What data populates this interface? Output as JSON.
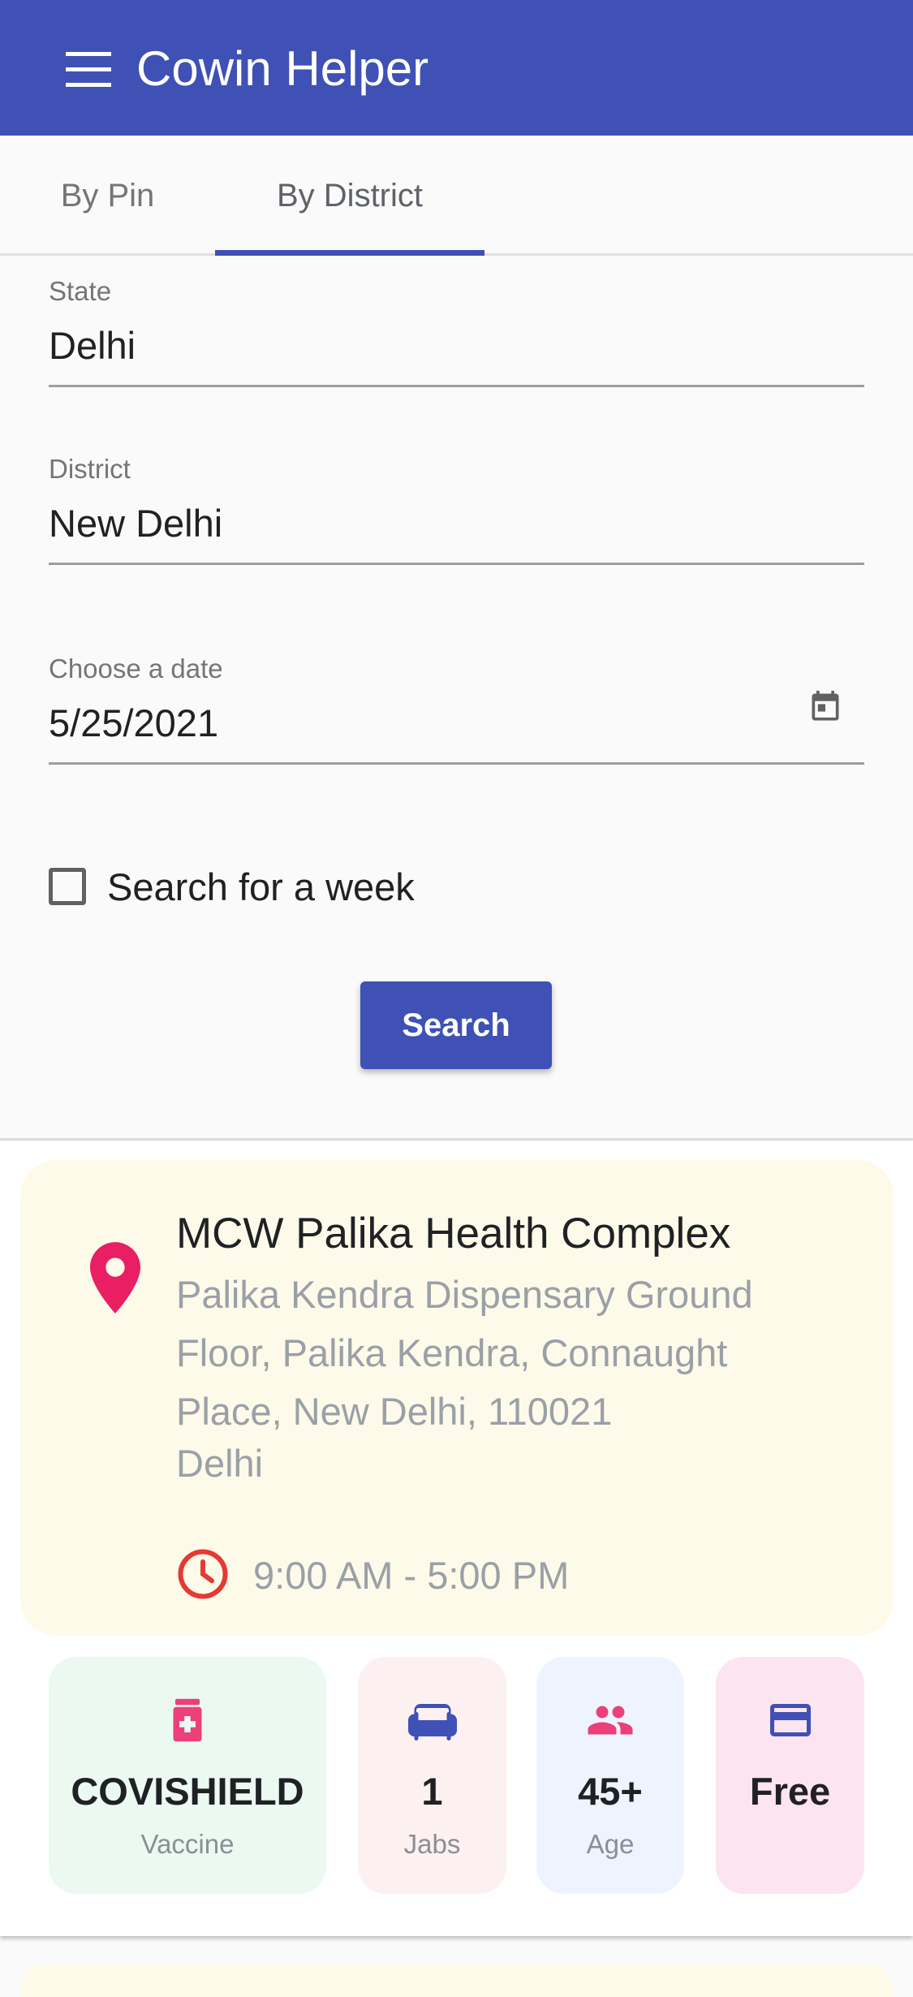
{
  "app": {
    "title": "Cowin Helper"
  },
  "icons": {
    "menu": "menu-icon",
    "calendar": "calendar-icon",
    "location": "location-pin-icon",
    "clock": "clock-icon",
    "vaccine": "medicine-bottle-icon",
    "jabs": "sofa-icon",
    "age": "people-icon",
    "fee": "credit-card-icon"
  },
  "colors": {
    "primary": "#3f51b5",
    "pin": "#e91e63",
    "clock": "#e53935"
  },
  "tabs": [
    {
      "label": "By Pin",
      "selected": false
    },
    {
      "label": "By District",
      "selected": true
    }
  ],
  "form": {
    "state": {
      "label": "State",
      "value": "Delhi"
    },
    "district": {
      "label": "District",
      "value": "New Delhi"
    },
    "date": {
      "label": "Choose a date",
      "value": "5/25/2021"
    },
    "week_checkbox": {
      "label": "Search for a week",
      "checked": false
    },
    "search_button": "Search"
  },
  "results": [
    {
      "name": "MCW Palika Health Complex",
      "address": "Palika Kendra Dispensary Ground Floor, Palika Kendra, Connaught Place, New Delhi, 110021",
      "state": "Delhi",
      "hours": "9:00 AM - 5:00 PM",
      "vaccine": {
        "value": "COVISHIELD",
        "caption": "Vaccine"
      },
      "jabs": {
        "value": "1",
        "caption": "Jabs"
      },
      "age": {
        "value": "45+",
        "caption": "Age"
      },
      "fee": {
        "value": "Free",
        "caption": ""
      }
    }
  ]
}
